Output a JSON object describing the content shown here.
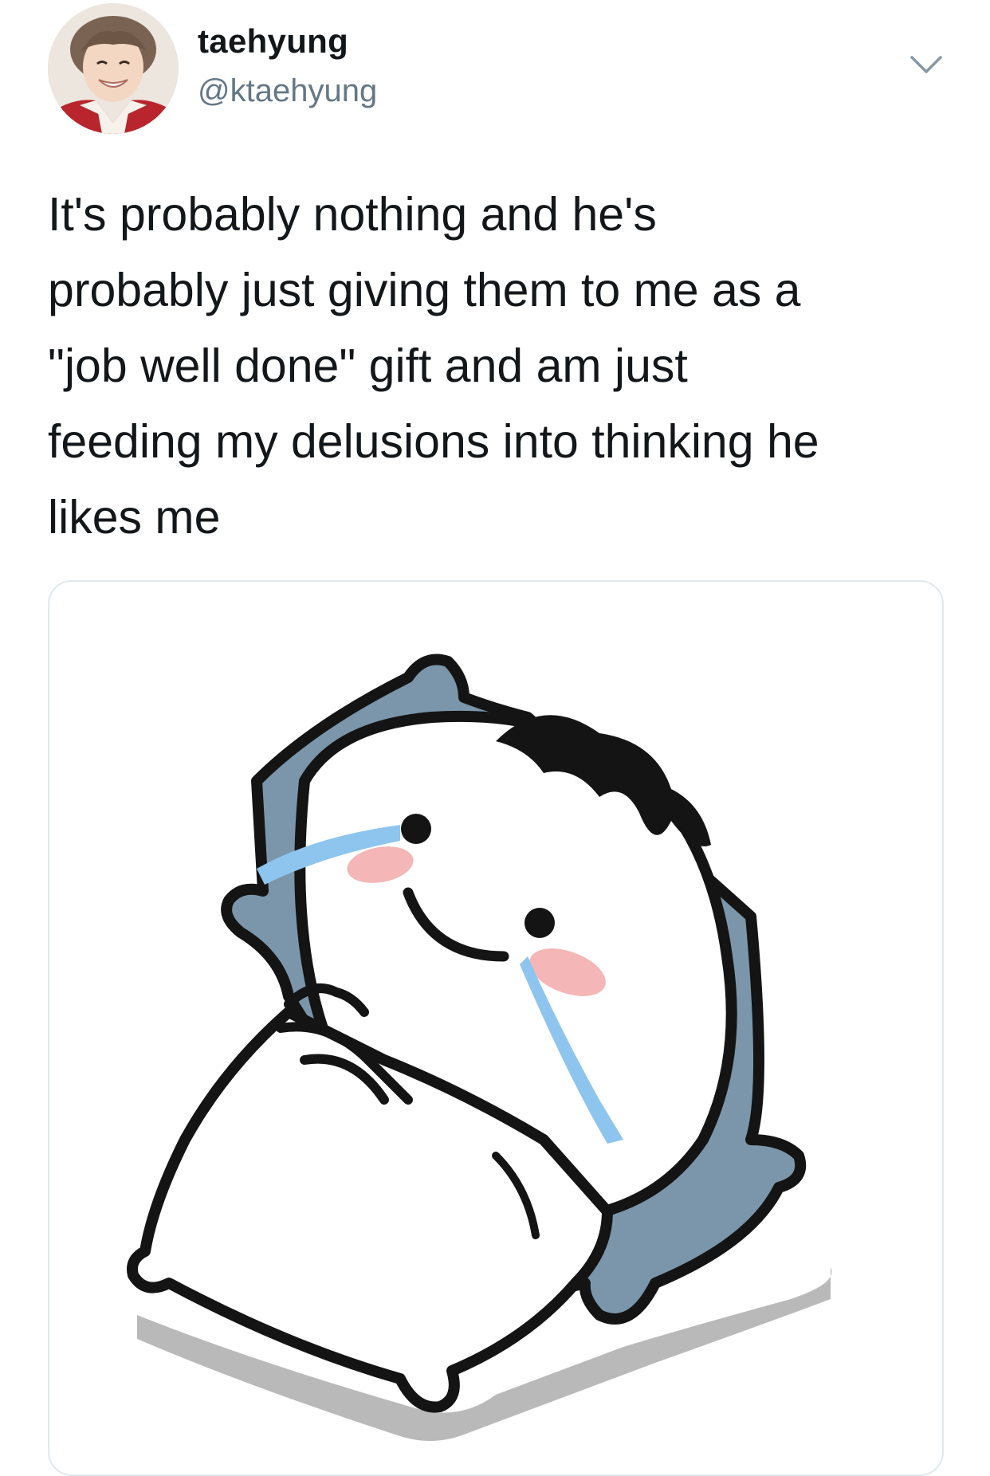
{
  "tweet": {
    "author_name": "taehyung",
    "author_handle": "@ktaehyung",
    "text": "It's probably nothing and he's\nprobably just giving them to me as a\n\"job well done\" gift and am just\nfeeding my delusions into thinking he\nlikes me",
    "menu_icon": "chevron-down-icon",
    "media_icon": "crying-cartoon-pillow-illustration"
  },
  "colors": {
    "text": "#14171a",
    "secondary_text": "#657786",
    "border": "#e1e8ed",
    "pillow_blue": "#7b96ab",
    "tear_blue": "#8ec5ef",
    "blush_pink": "#f4b6b6"
  }
}
